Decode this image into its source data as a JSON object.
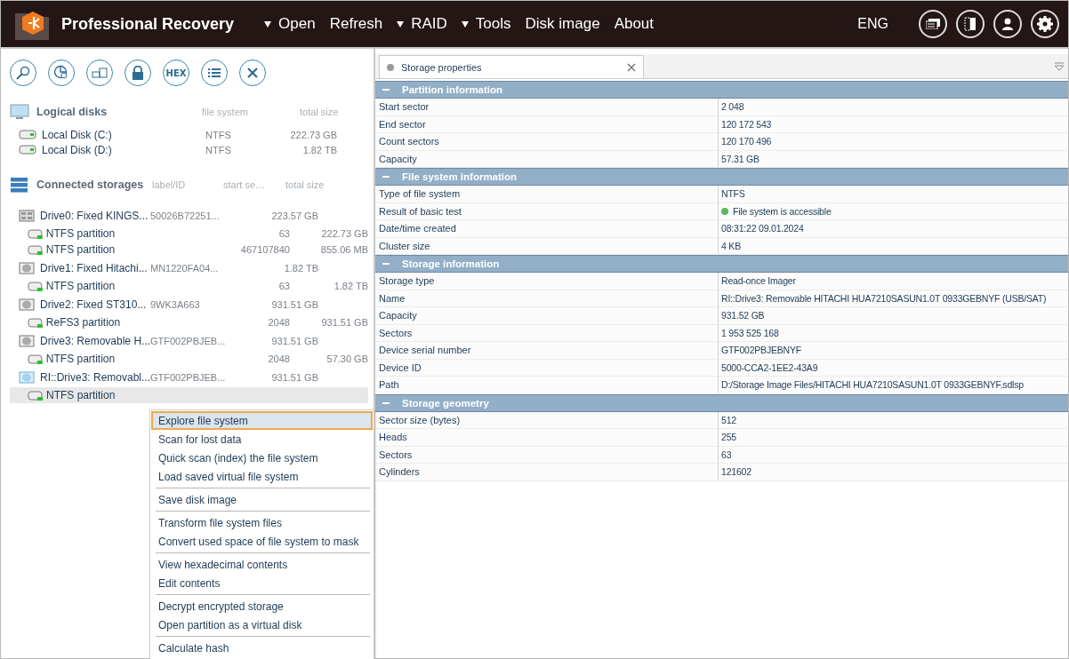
{
  "app": {
    "title": "Professional Recovery",
    "menu": [
      {
        "label": "Open",
        "dropdown": true
      },
      {
        "label": "Refresh",
        "dropdown": false
      },
      {
        "label": "RAID",
        "dropdown": true
      },
      {
        "label": "Tools",
        "dropdown": true
      },
      {
        "label": "Disk image",
        "dropdown": false
      },
      {
        "label": "About",
        "dropdown": false
      }
    ],
    "language": "ENG"
  },
  "toolbar": {
    "hex_label": "HEX"
  },
  "logical_disks": {
    "title": "Logical disks",
    "columns": [
      "file system",
      "total size"
    ],
    "items": [
      {
        "name": "Local Disk (C:)",
        "file_system": "NTFS",
        "size": "222.73 GB"
      },
      {
        "name": "Local Disk (D:)",
        "file_system": "NTFS",
        "size": "1.82 TB"
      }
    ]
  },
  "connected_storages": {
    "title": "Connected storages",
    "columns": [
      "label/ID",
      "start se…",
      "total size"
    ],
    "drives": [
      {
        "kind": "ssd",
        "name": "Drive0: Fixed KINGS...",
        "label": "50026B72251...",
        "size": "223.57 GB",
        "children": [
          {
            "name": "NTFS partition",
            "start": "63",
            "size": "222.73 GB",
            "selected": false
          },
          {
            "name": "NTFS partition",
            "start": "467107840",
            "size": "855.06 MB",
            "selected": false
          }
        ]
      },
      {
        "kind": "hdd",
        "name": "Drive1: Fixed Hitachi...",
        "label": "MN1220FA04...",
        "size": "1.82 TB",
        "children": [
          {
            "name": "NTFS partition",
            "start": "63",
            "size": "1.82 TB",
            "selected": false
          }
        ]
      },
      {
        "kind": "hdd",
        "name": "Drive2: Fixed ST310...",
        "label": "9WK3A663",
        "size": "931.51 GB",
        "children": [
          {
            "name": "ReFS3 partition",
            "start": "2048",
            "size": "931.51 GB",
            "selected": false
          }
        ]
      },
      {
        "kind": "hdd",
        "name": "Drive3: Removable H...",
        "label": "GTF002PBJEB...",
        "size": "931.51 GB",
        "children": [
          {
            "name": "NTFS partition",
            "start": "2048",
            "size": "57.30 GB",
            "selected": false
          }
        ]
      },
      {
        "kind": "image",
        "name": "RI::Drive3: Removabl...",
        "label": "GTF002PBJEB...",
        "size": "931.51 GB",
        "children": [
          {
            "name": "NTFS partition",
            "selected": true
          }
        ]
      }
    ]
  },
  "context_menu": {
    "groups": [
      [
        {
          "label": "Explore file system",
          "selected": true
        },
        {
          "label": "Scan for lost data",
          "selected": false
        },
        {
          "label": "Quick scan (index) the file system",
          "selected": false
        },
        {
          "label": "Load saved virtual file system",
          "selected": false
        }
      ],
      [
        {
          "label": "Save disk image",
          "selected": false
        }
      ],
      [
        {
          "label": "Transform file system files",
          "selected": false
        },
        {
          "label": "Convert used space of file system to mask",
          "selected": false
        }
      ],
      [
        {
          "label": "View hexadecimal contents",
          "selected": false
        },
        {
          "label": "Edit contents",
          "selected": false
        }
      ],
      [
        {
          "label": "Decrypt encrypted storage",
          "selected": false
        },
        {
          "label": "Open partition as a virtual disk",
          "selected": false
        }
      ],
      [
        {
          "label": "Calculate hash",
          "selected": false
        }
      ]
    ]
  },
  "tabs": [
    {
      "label": "Storage properties",
      "selected": true
    }
  ],
  "sections": [
    {
      "title": "Partition information",
      "expanded": true,
      "rows": [
        {
          "label": "Start sector",
          "value": "2 048"
        },
        {
          "label": "End sector",
          "value": "120 172 543"
        },
        {
          "label": "Count sectors",
          "value": "120 170 496"
        },
        {
          "label": "Capacity",
          "value": "57.31 GB"
        }
      ]
    },
    {
      "title": "File system information",
      "expanded": true,
      "rows": [
        {
          "label": "Type of file system",
          "value": "NTFS"
        },
        {
          "label": "Result of basic test",
          "value": "File system is accessible",
          "color": "#5cb85c"
        },
        {
          "label": "Date/time created",
          "value": "08:31:22 09.01.2024"
        },
        {
          "label": "Cluster size",
          "value": "4 KB"
        }
      ]
    },
    {
      "title": "Storage information",
      "expanded": true,
      "rows": [
        {
          "label": "Storage type",
          "value": "Read-once Imager"
        },
        {
          "label": "Name",
          "value": "RI::Drive3: Removable HITACHI HUA7210SASUN1.0T 0933GEBNYF (USB/SAT)"
        },
        {
          "label": "Capacity",
          "value": "931.52 GB"
        },
        {
          "label": "Sectors",
          "value": "1 953 525 168"
        },
        {
          "label": "Device serial number",
          "value": "GTF002PBJEBNYF"
        },
        {
          "label": "Device ID",
          "value": "5000-CCA2-1EE2-43A9"
        },
        {
          "label": "Path",
          "value": "D:/Storage Image Files/HITACHI HUA7210SASUN1.0T 0933GEBNYF.sdlsp"
        }
      ]
    },
    {
      "title": "Storage geometry",
      "expanded": true,
      "rows": [
        {
          "label": "Sector size (bytes)",
          "value": "512"
        },
        {
          "label": "Heads",
          "value": "255"
        },
        {
          "label": "Sectors",
          "value": "63"
        },
        {
          "label": "Cylinders",
          "value": "121602"
        }
      ]
    }
  ]
}
